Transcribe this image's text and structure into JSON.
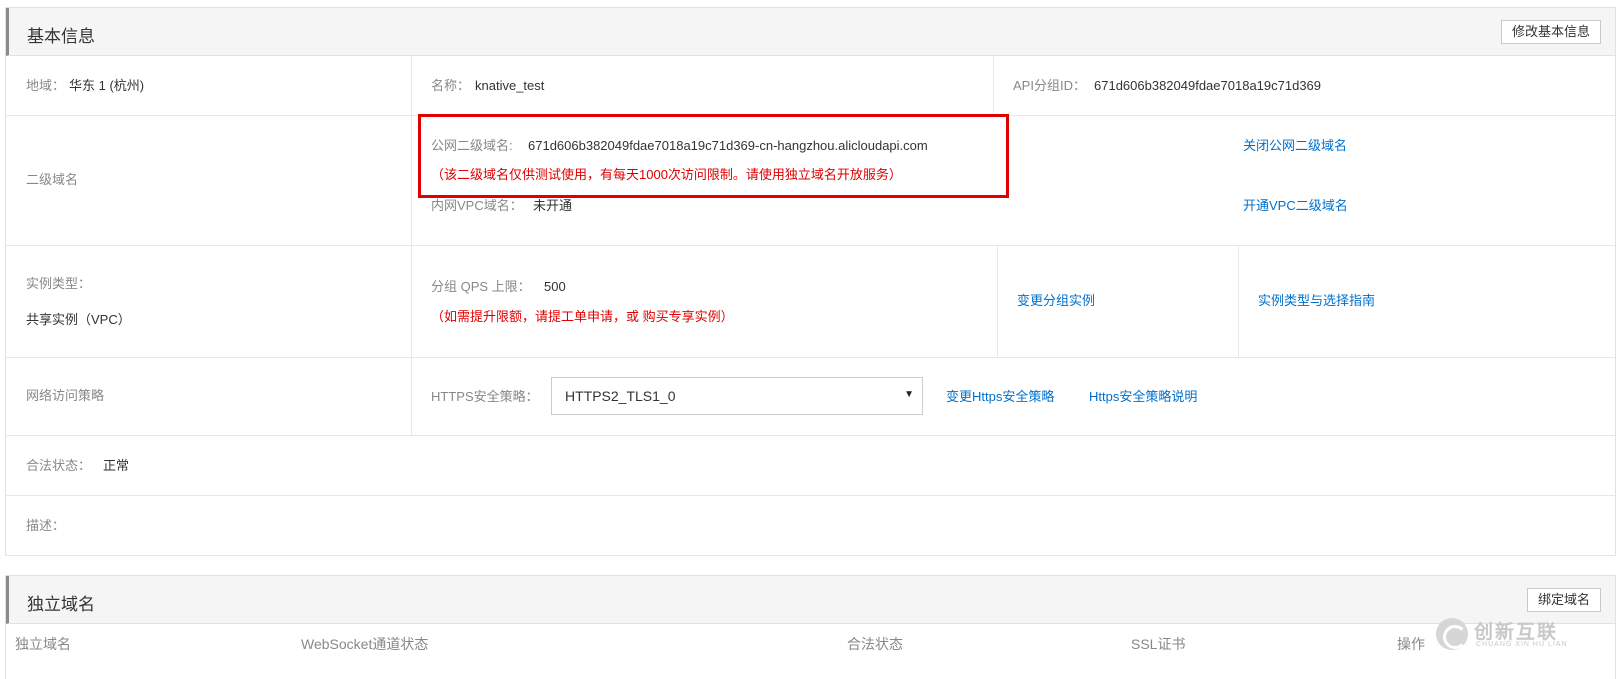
{
  "basic": {
    "title": "基本信息",
    "edit_button": "修改基本信息",
    "region_label": "地域：",
    "region_value": "华东 1 (杭州)",
    "name_label": "名称：",
    "name_value": "knative_test",
    "group_id_label": "API分组ID：",
    "group_id_value": "671d606b382049fdae7018a19c71d369",
    "subdomain_label": "二级域名",
    "public_subdomain_label": "公网二级域名:",
    "public_subdomain_value": "671d606b382049fdae7018a19c71d369-cn-hangzhou.alicloudapi.com",
    "subdomain_warning": "（该二级域名仅供测试使用，有每天1000次访问限制。请使用独立域名开放服务）",
    "vpc_subdomain_label": "内网VPC域名：",
    "vpc_subdomain_value": "未开通",
    "close_public_link": "关闭公网二级域名",
    "open_vpc_link": "开通VPC二级域名",
    "instance_type_label": "实例类型：",
    "instance_type_value": "共享实例（VPC）",
    "qps_label": "分组 QPS 上限：",
    "qps_value": "500",
    "qps_note": "（如需提升限额，请提工单申请，或 购买专享实例）",
    "change_instance_link": "变更分组实例",
    "instance_guide_link": "实例类型与选择指南",
    "network_policy_label": "网络访问策略",
    "https_policy_label": "HTTPS安全策略：",
    "https_policy_value": "HTTPS2_TLS1_0",
    "change_https_link": "变更Https安全策略",
    "https_doc_link": "Https安全策略说明",
    "legal_status_label": "合法状态：",
    "legal_status_value": "正常",
    "description_label": "描述："
  },
  "domains": {
    "title": "独立域名",
    "bind_button": "绑定域名",
    "columns": [
      "独立域名",
      "WebSocket通道状态",
      "合法状态",
      "SSL证书",
      "操作"
    ]
  },
  "watermark": {
    "text": "创新互联",
    "subtext": "CHUANG XIN HU LIAN"
  }
}
